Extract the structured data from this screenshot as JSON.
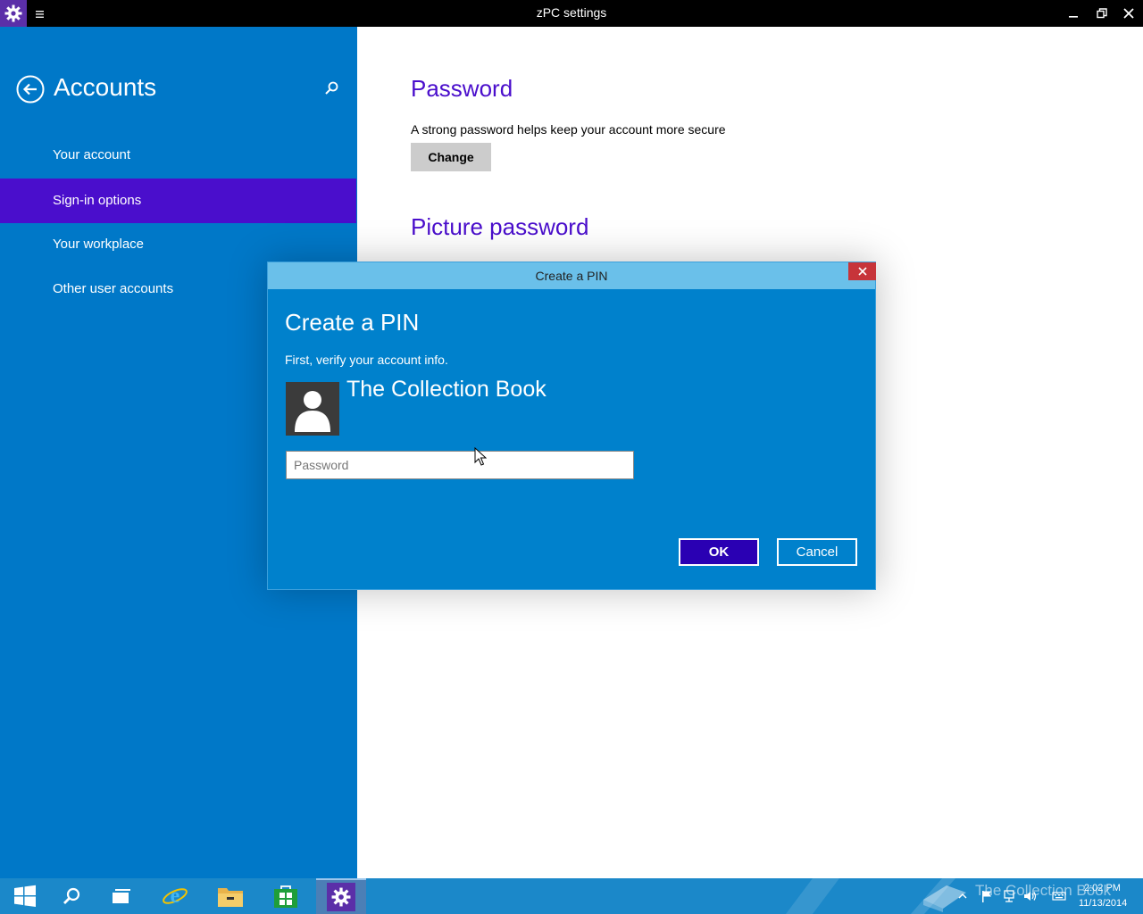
{
  "window": {
    "title": "zPC settings"
  },
  "sidebar": {
    "title": "Accounts",
    "items": [
      {
        "label": "Your account",
        "selected": false
      },
      {
        "label": "Sign-in options",
        "selected": true
      },
      {
        "label": "Your workplace",
        "selected": false
      },
      {
        "label": "Other user accounts",
        "selected": false
      }
    ]
  },
  "main": {
    "password": {
      "title": "Password",
      "description": "A strong password helps keep your account more secure",
      "button": "Change"
    },
    "picture_password": {
      "title": "Picture password"
    }
  },
  "dialog": {
    "titlebar": "Create a PIN",
    "heading": "Create a PIN",
    "subtitle": "First, verify your account info.",
    "username": "The Collection Book",
    "password_placeholder": "Password",
    "ok_label": "OK",
    "cancel_label": "Cancel"
  },
  "taskbar": {
    "watermark": "The Collection Book",
    "time": "2:02 PM",
    "date": "11/13/2014"
  },
  "colors": {
    "sidebar_bg": "#0078c8",
    "accent": "#4a0ecc",
    "dialog_bg": "#0081cc",
    "dialog_titlebar": "#6ac0ea",
    "taskbar": "#1b88c9"
  }
}
